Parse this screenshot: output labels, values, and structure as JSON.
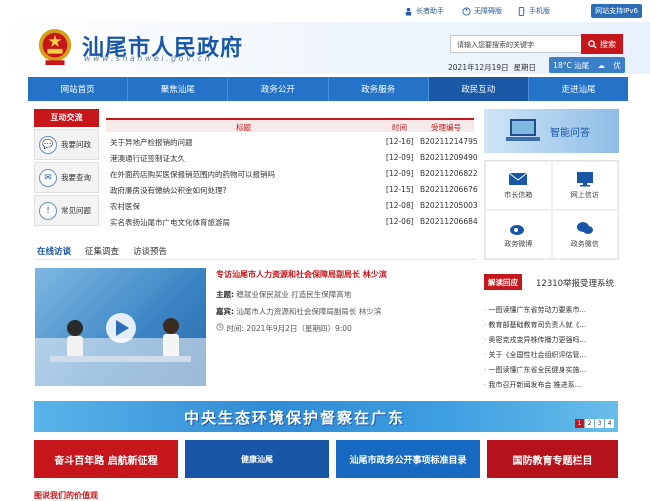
{
  "topbar": {
    "elder_label": "长者助手",
    "access_label": "无障碍版",
    "mobile_label": "手机版",
    "ipv6_label": "网站支持IPv6"
  },
  "header": {
    "site_name": "汕尾市人民政府",
    "site_url": "www.shanwei.gov.cn",
    "search_placeholder": "请输入您要搜索的关键字",
    "search_button": "搜索",
    "date": "2021年12月19日",
    "weekday": "星期日",
    "weather": "18°C 汕尾",
    "air": "优"
  },
  "nav": [
    "网站首页",
    "聚焦汕尾",
    "政务公开",
    "政务服务",
    "政民互动",
    "走进汕尾"
  ],
  "sidebar": {
    "title": "互动交流",
    "items": [
      "我要问政",
      "我要查询",
      "常见问题"
    ]
  },
  "table": {
    "headers": {
      "title": "标题",
      "time": "时间",
      "code": "受理编号"
    },
    "rows": [
      {
        "title": "关于异地产检报销的问题",
        "time": "[12-16]",
        "code": "B20211214795"
      },
      {
        "title": "港澳通行证签制证太久",
        "time": "[12-09]",
        "code": "B20211209490"
      },
      {
        "title": "在外面药店购买医保报销范围内的药物可以报销吗",
        "time": "[12-09]",
        "code": "B20211206822"
      },
      {
        "title": "政府廉房没有缴纳公积金如何处理?",
        "time": "[12-15]",
        "code": "B20211206676"
      },
      {
        "title": "农村医保",
        "time": "[12-08]",
        "code": "B20211205003"
      },
      {
        "title": "实名表扬汕尾市广电文化体育旅游局",
        "time": "[12-06]",
        "code": "B20211206684"
      }
    ]
  },
  "tabs": [
    "在线访谈",
    "征集调查",
    "访谈预告"
  ],
  "interview": {
    "title": "专访汕尾市人力资源和社会保障局副局长 林少滨",
    "topic_label": "主题:",
    "topic": "稳就业保民就业 打造民生保障高地",
    "guest_label": "嘉宾:",
    "guest": "汕尾市人力资源和社会保障局副局长 林少滨",
    "time_label": "时间:",
    "time": "2021年9月2日（星期四）9:00"
  },
  "right": {
    "smart_qa": "智能问答",
    "grid": [
      "市长信箱",
      "网上信访",
      "政务微博",
      "政务微信"
    ],
    "tab": "解读回应",
    "hotline": "12310举报受理系统",
    "list": [
      "一图读懂广东省劳动力要素市...",
      "教育部基础教育司负责人就《...",
      "奥密克戎变异株传播力更强吗...",
      "关于《全国性社会组织评估管...",
      "一图读懂广东省全民健身实施...",
      "我市召开新闻发布会 推进系..."
    ]
  },
  "banner": {
    "text": "中央生态环境保护督察在广东",
    "pages": [
      "1",
      "2",
      "3",
      "4"
    ]
  },
  "small_banners": [
    {
      "text": "奋斗百年路 启航新征程",
      "color": "#c7161b"
    },
    {
      "text": "健康汕尾",
      "color": "#1a56a8"
    },
    {
      "text": "汕尾市政务公开事项标准目录",
      "color": "#1769c1"
    },
    {
      "text": "国防教育专题栏目",
      "color": "#b5121b"
    }
  ],
  "bottom_title": "图说我们的价值观"
}
